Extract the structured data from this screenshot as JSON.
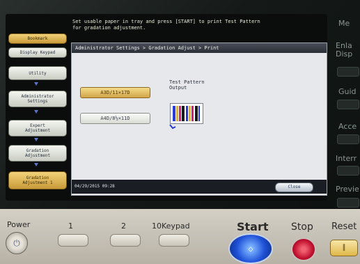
{
  "screen": {
    "message": "Set usable paper in tray and press [START] to print Test Pattern\nfor gradation adjustment.",
    "breadcrumb": "Administrator Settings > Gradation Adjust > Print"
  },
  "sidebar": {
    "items": [
      {
        "label": "Bookmark"
      },
      {
        "label": "Display Keypad"
      },
      {
        "label": "Utility"
      },
      {
        "label": "Administrator\nSettings"
      },
      {
        "label": "Expert\nAdjustment"
      },
      {
        "label": "Gradation\nAdjustment"
      },
      {
        "label": "Gradation\nAdjustment 1"
      }
    ]
  },
  "paper_sizes": {
    "option_1": "A3D/11×17D",
    "option_2": "A4D/8½×11D",
    "selected": "A3D/11×17D"
  },
  "output": {
    "label": "Test Pattern\nOutput"
  },
  "footer": {
    "datetime": "04/29/2015   09:28",
    "close_label": "Close"
  },
  "hardware_right": {
    "labels": [
      "Me",
      "Enla\nDisp",
      "Guid",
      "Acce",
      "Interr",
      "Previe"
    ]
  },
  "hardware_bottom": {
    "power_label": "Power",
    "key_1_label": "1",
    "key_2_label": "2",
    "keypad_label": "10Keypad",
    "start_label": "Start",
    "stop_label": "Stop",
    "reset_label": "Reset"
  },
  "colors": {
    "selected_button": "#e3b85e",
    "start_button": "#1f52d8",
    "stop_button": "#c01030"
  }
}
